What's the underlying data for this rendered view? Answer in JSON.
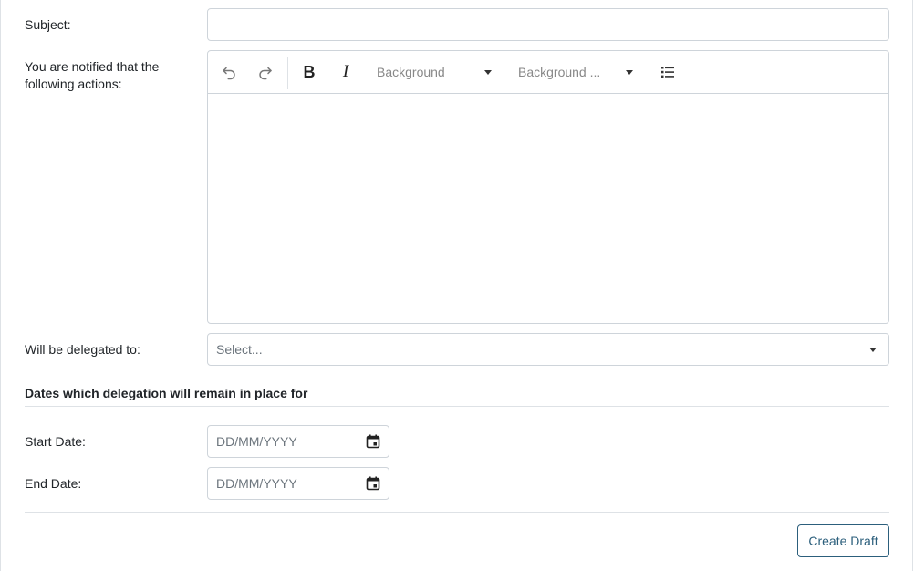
{
  "form": {
    "subject_label": "Subject:",
    "subject_value": "",
    "notified_label": "You are notified that the following actions:",
    "editor": {
      "undo_icon": "undo-icon",
      "redo_icon": "redo-icon",
      "bold_label": "B",
      "italic_label": "I",
      "text_color_label": "Background",
      "background_color_label": "Background ...",
      "list_icon": "bullet-list-icon",
      "content": ""
    },
    "delegated_label": "Will be delegated to:",
    "delegated_placeholder": "Select...",
    "dates_section_title": "Dates which delegation will remain in place for",
    "start_date_label": "Start Date:",
    "start_date_placeholder": "DD/MM/YYYY",
    "end_date_label": "End Date:",
    "end_date_placeholder": "DD/MM/YYYY",
    "create_draft_label": "Create Draft"
  },
  "colors": {
    "border": "#ced4da",
    "divider": "#dee2e6",
    "placeholder": "#6c757d",
    "button": "#2c5f7c"
  }
}
